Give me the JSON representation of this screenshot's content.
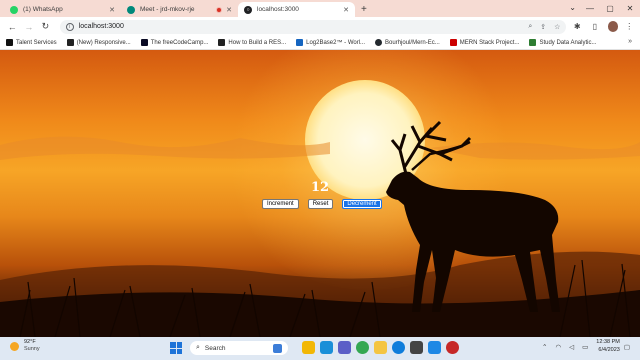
{
  "browser": {
    "tabs": [
      {
        "title": "(1) WhatsApp",
        "active": false,
        "favicon_color": "#25d366"
      },
      {
        "title": "Meet - jrd-mkov-rje",
        "active": false,
        "favicon_color": "#00897b"
      },
      {
        "title": "localhost:3000",
        "active": true,
        "favicon_color": "#202124"
      }
    ],
    "new_tab_label": "+",
    "address": "localhost:3000",
    "bookmarks": [
      {
        "label": "Talent Services",
        "icon_color": "#111111"
      },
      {
        "label": "(New) Responsive...",
        "icon_color": "#222222"
      },
      {
        "label": "The freeCodeCamp...",
        "icon_color": "#0a0a23"
      },
      {
        "label": "How to Build a RES...",
        "icon_color": "#222222"
      },
      {
        "label": "Log2Base2™ - Worl...",
        "icon_color": "#1565c0"
      },
      {
        "label": "Bourhjoul/Mern-Ec...",
        "icon_color": "#24292e"
      },
      {
        "label": "MERN Stack Project...",
        "icon_color": "#cc0000"
      },
      {
        "label": "Study Data Analytic...",
        "icon_color": "#2e7d32"
      }
    ],
    "bookmarks_more": "»"
  },
  "app": {
    "count": "12",
    "buttons": {
      "increment": "Increment",
      "reset": "Reset",
      "decrement": "Decrement"
    }
  },
  "taskbar": {
    "weather": {
      "temp": "92°F",
      "condition": "Sunny"
    },
    "search_placeholder": "Search",
    "time": "12:38 PM",
    "date": "6/4/2023",
    "apps": [
      {
        "name": "file-explorer",
        "color": "#f2b705"
      },
      {
        "name": "edge",
        "color": "#1a8fd8"
      },
      {
        "name": "teams",
        "color": "#5b5fc7"
      },
      {
        "name": "chrome",
        "color": "#34a853"
      },
      {
        "name": "folder",
        "color": "#f4c542"
      },
      {
        "name": "edge-alt",
        "color": "#0f7ddb"
      },
      {
        "name": "store",
        "color": "#444444"
      },
      {
        "name": "vscode",
        "color": "#1e88e5"
      },
      {
        "name": "app-red",
        "color": "#c62828"
      }
    ]
  }
}
